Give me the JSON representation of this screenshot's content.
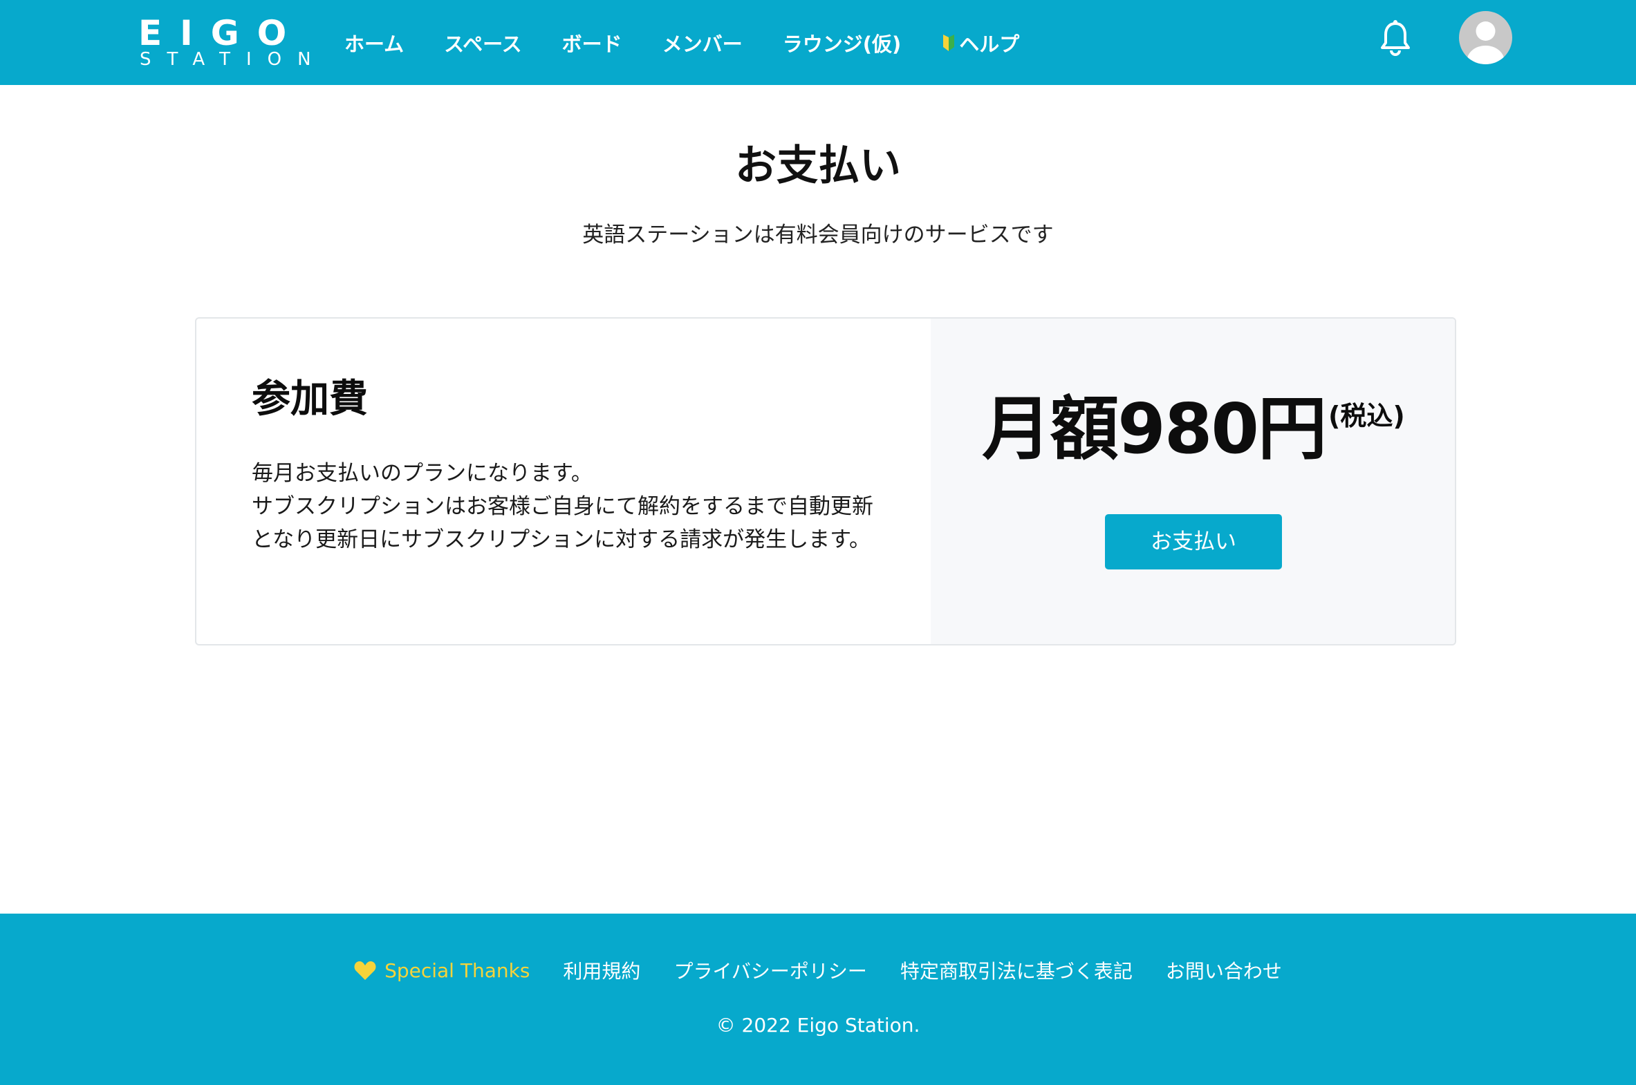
{
  "header": {
    "logo_main": "EIGO",
    "logo_sub": "STATION",
    "nav": [
      {
        "label": "ホーム"
      },
      {
        "label": "スペース"
      },
      {
        "label": "ボード"
      },
      {
        "label": "メンバー"
      },
      {
        "label": "ラウンジ(仮)"
      },
      {
        "label": "ヘルプ",
        "icon": "beginner-leaf-icon"
      }
    ],
    "bell_icon": "bell-icon",
    "avatar_icon": "user-avatar-icon"
  },
  "main": {
    "title": "お支払い",
    "subtitle": "英語ステーションは有料会員向けのサービスです",
    "plan": {
      "title": "参加費",
      "desc_line1": "毎月お支払いのプランになります。",
      "desc_line2": "サブスクリプションはお客様ご自身にて解約をするまで自動更新となり更新日にサブスクリプションに対する請求が発生します。",
      "price": "月額980円",
      "tax_note": "(税込)",
      "pay_button": "お支払い"
    }
  },
  "footer": {
    "links": [
      {
        "label": "Special Thanks",
        "icon": "heart-icon"
      },
      {
        "label": "利用規約"
      },
      {
        "label": "プライバシーポリシー"
      },
      {
        "label": "特定商取引法に基づく表記"
      },
      {
        "label": "お問い合わせ"
      }
    ],
    "copyright": "© 2022 Eigo Station."
  },
  "colors": {
    "brand": "#07a9cc",
    "accent_yellow": "#f6d33a",
    "panel_bg": "#f7f8fa",
    "border": "#e3e6e9"
  }
}
